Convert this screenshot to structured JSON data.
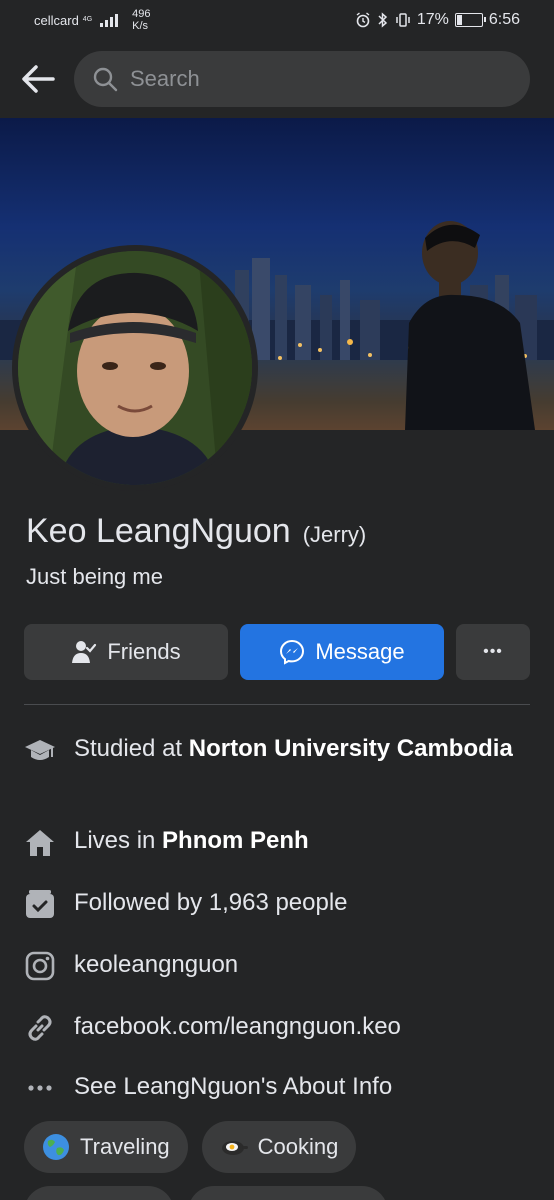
{
  "status_bar": {
    "carrier": "cellcard",
    "network": "4G",
    "speed_value": "496",
    "speed_unit": "K/s",
    "battery": "17%",
    "time": "6:56"
  },
  "search": {
    "placeholder": "Search"
  },
  "profile": {
    "name": "Keo LeangNguon",
    "alternate_name": "(Jerry)",
    "bio": "Just being me"
  },
  "actions": {
    "friends_label": "Friends",
    "message_label": "Message",
    "more_label": "•••"
  },
  "info": {
    "studied_prefix": "Studied at ",
    "studied_place": "Norton University Cambodia",
    "lives_prefix": "Lives in ",
    "lives_place": "Phnom Penh",
    "followers": "Followed by 1,963 people",
    "instagram": "keoleangnguon",
    "website": "facebook.com/leangnguon.keo",
    "about": "See LeangNguon's About Info"
  },
  "hobbies": [
    {
      "label": "Traveling",
      "icon": "globe-emoji"
    },
    {
      "label": "Cooking",
      "icon": "cooking-emoji"
    }
  ],
  "colors": {
    "background": "#242526",
    "surface": "#3a3b3c",
    "accent": "#2374e1",
    "text": "#e4e6eb"
  }
}
